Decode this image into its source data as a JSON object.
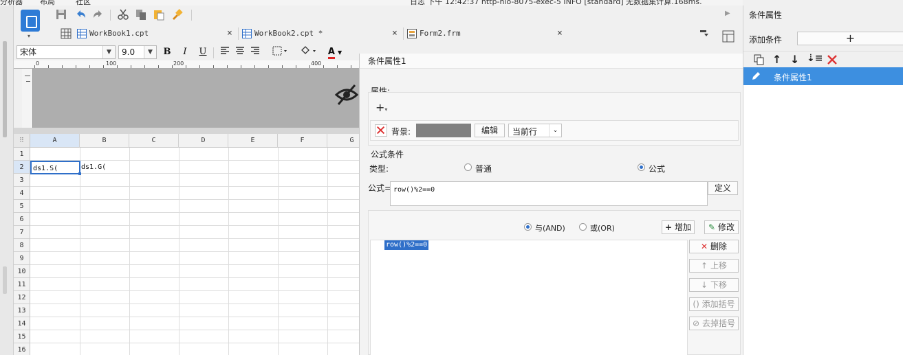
{
  "menu": {
    "items": [
      "分析器",
      "布局",
      "社区"
    ],
    "status_text": "日志 下午 12:42:37 http-nio-8075-exec-5 INFO [standard] 无数据集计算.168ms."
  },
  "tabs": [
    {
      "label": "WorkBook1.cpt",
      "close": "×"
    },
    {
      "label": "WorkBook2.cpt *",
      "close": "×"
    },
    {
      "label": "Form2.frm",
      "close": "×"
    }
  ],
  "format": {
    "font": "宋体",
    "size": "9.0",
    "bold": "B",
    "italic": "I",
    "underline": "U",
    "font_color": "A"
  },
  "ruler": {
    "marks": [
      "0",
      "100",
      "200",
      "400"
    ]
  },
  "grid": {
    "columns": [
      "A",
      "B",
      "C",
      "D",
      "E",
      "F",
      "G"
    ],
    "rows": [
      "1",
      "2",
      "3",
      "4",
      "5",
      "6",
      "7",
      "8",
      "9",
      "10",
      "11",
      "12",
      "13",
      "14",
      "15",
      "16"
    ],
    "cells": {
      "A2": "ds1.S(",
      "B2": "ds1.G("
    }
  },
  "dialog": {
    "title": "条件属性1",
    "attr_label": "属性:",
    "add_symbol": "+",
    "background_label": "背景:",
    "edit_button": "编辑",
    "scope_value": "当前行",
    "formula_section": "公式条件",
    "type_label": "类型:",
    "type_normal": "普通",
    "type_formula": "公式",
    "formula_label": "公式=",
    "formula_value": "row()%2==0",
    "define_button": "定义",
    "and_label": "与(AND)",
    "or_label": "或(OR)",
    "add_button": "增加",
    "modify_button": "修改",
    "delete_button": "删除",
    "up_button": "上移",
    "down_button": "下移",
    "add_paren_button": "添加括号",
    "remove_paren_button": "去掉括号",
    "list_items": [
      "row()%2==0"
    ],
    "bg_color": "#808080"
  },
  "right_panel": {
    "title": "条件属性",
    "add_condition_label": "添加条件",
    "add_symbol": "+",
    "items": [
      "条件属性1"
    ]
  }
}
